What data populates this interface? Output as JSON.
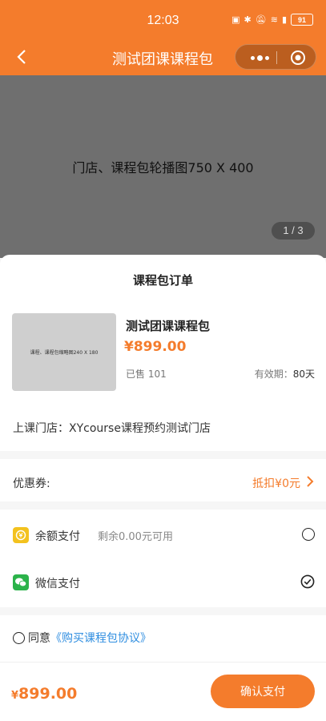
{
  "status_bar": {
    "time": "12:03",
    "battery": "91"
  },
  "nav": {
    "title": "测试团课课程包"
  },
  "banner": {
    "text": "门店、课程包轮播图750 X 400",
    "counter": "1 / 3"
  },
  "order": {
    "title": "课程包订单",
    "thumb_text": "课程、课程包缩略图240 X 180",
    "product_name": "测试团课课程包",
    "price": "¥899.00",
    "sold": "已售 101",
    "validity_label": "有效期：",
    "validity_value": "80天",
    "store": "上课门店：XYcourse课程预约测试门店"
  },
  "coupon": {
    "label": "优惠券:",
    "value": "抵扣¥0元"
  },
  "payment": [
    {
      "label": "余额支付",
      "sub": "剩余0.00元可用",
      "icon": "wallet-icon",
      "selected": false
    },
    {
      "label": "微信支付",
      "sub": "",
      "icon": "wechat-icon",
      "selected": true
    }
  ],
  "agreement": {
    "prefix": "同意",
    "link": "《购买课程包协议》"
  },
  "footer": {
    "currency": "¥",
    "total": "899.00",
    "confirm": "确认支付"
  },
  "colors": {
    "accent": "#f47c2c",
    "link": "#2f8ee0",
    "wechat": "#2bb34a",
    "wallet": "#f3c21e"
  }
}
